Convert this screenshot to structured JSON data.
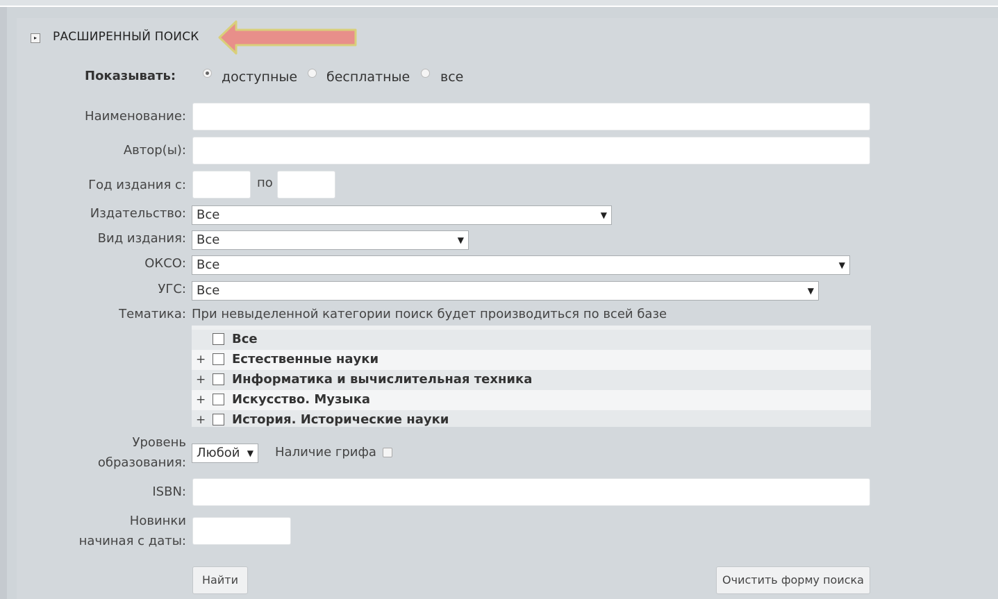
{
  "header": {
    "title": "РАСШИРЕННЫЙ ПОИСК",
    "toggle_glyph": "▸",
    "arrow_color": "#e88f8a",
    "arrow_border_color": "#d9cf7a"
  },
  "show": {
    "label": "Показывать:",
    "options": [
      {
        "label": "доступные",
        "checked": true
      },
      {
        "label": "бесплатные",
        "checked": false
      },
      {
        "label": "все",
        "checked": false
      }
    ]
  },
  "fields": {
    "title_label": "Наименование:",
    "title_value": "",
    "author_label": "Автор(ы):",
    "author_value": "",
    "year_label": "Год издания с:",
    "year_from": "",
    "year_to_label": "по",
    "year_to": "",
    "publisher_label": "Издательство:",
    "publisher_value": "Все",
    "type_label": "Вид издания:",
    "type_value": "Все",
    "okso_label": "ОКСО:",
    "okso_value": "Все",
    "ugs_label": "УГС:",
    "ugs_value": "Все",
    "topic_label": "Тематика:",
    "topic_note": "При невыделенной категории поиск будет производиться по всей базе",
    "level_label_1": "Уровень",
    "level_label_2": "образования:",
    "level_value": "Любой",
    "grif_label": "Наличие грифа",
    "isbn_label": "ISBN:",
    "isbn_value": "",
    "new_label_1": "Новинки",
    "new_label_2": "начиная с даты:",
    "new_value": ""
  },
  "topics": [
    {
      "label": "Все",
      "expandable": false
    },
    {
      "label": "Естественные науки",
      "expandable": true
    },
    {
      "label": "Информатика и вычислительная техника",
      "expandable": true
    },
    {
      "label": "Искусство. Музыка",
      "expandable": true
    },
    {
      "label": "История. Исторические науки",
      "expandable": true
    }
  ],
  "buttons": {
    "find": "Найти",
    "clear": "Очистить форму поиска"
  },
  "icons": {
    "caret": "▼",
    "plus": "+"
  }
}
